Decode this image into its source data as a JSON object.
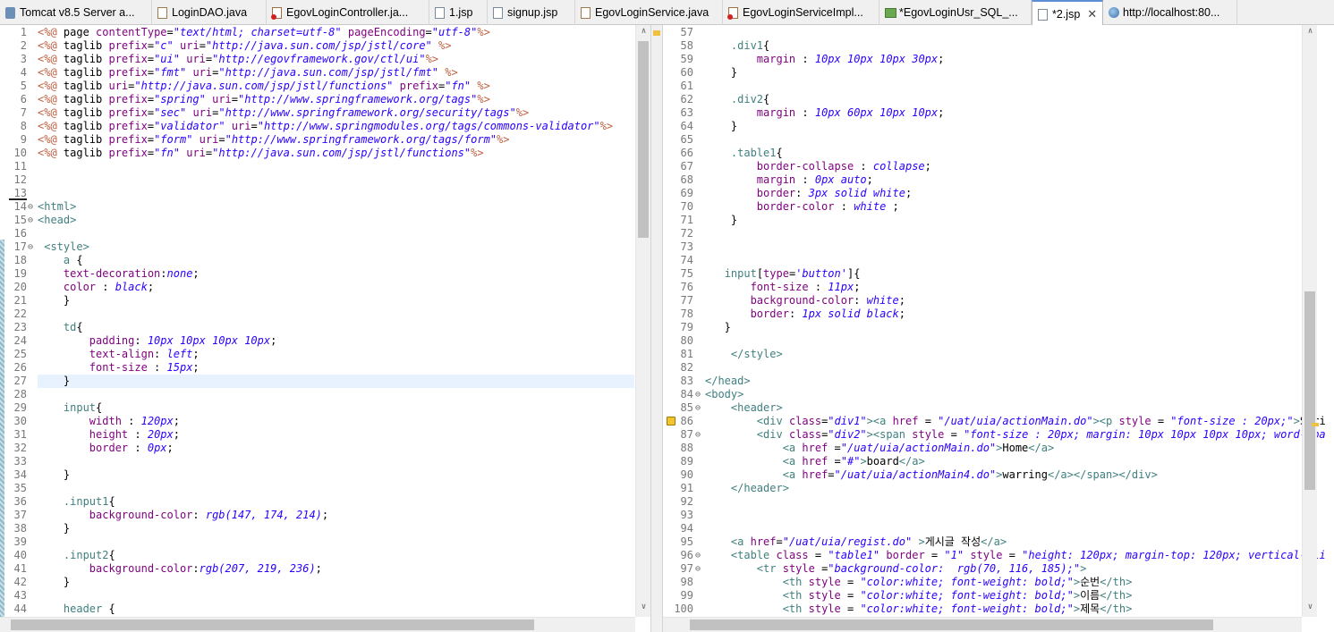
{
  "tabs": [
    {
      "label": "Tomcat v8.5 Server a...",
      "icon": "server-icon",
      "type": "srv",
      "width": 170
    },
    {
      "label": "LoginDAO.java",
      "icon": "java-file-icon",
      "type": "java",
      "width": 128
    },
    {
      "label": "EgovLoginController.ja...",
      "icon": "java-error-icon",
      "type": "err",
      "width": 182
    },
    {
      "label": "1.jsp",
      "icon": "jsp-file-icon",
      "type": "jsp",
      "width": 65
    },
    {
      "label": "signup.jsp",
      "icon": "jsp-file-icon",
      "type": "jsp",
      "width": 98
    },
    {
      "label": "EgovLoginService.java",
      "icon": "java-file-icon",
      "type": "java",
      "width": 165
    },
    {
      "label": "EgovLoginServiceImpl...",
      "icon": "java-error-icon",
      "type": "err",
      "width": 175
    },
    {
      "label": "*EgovLoginUsr_SQL_...",
      "icon": "sql-file-icon",
      "type": "sql",
      "width": 170
    },
    {
      "label": "*2.jsp",
      "icon": "jsp-file-icon",
      "type": "jsp",
      "width": 80,
      "active": true,
      "close": "✕"
    },
    {
      "label": "http://localhost:80...",
      "icon": "globe-icon",
      "type": "globe",
      "width": 150
    }
  ],
  "left_lines": [
    {
      "n": "1",
      "h": "<span class='jd'>&lt;%@</span> page <span class='p'>contentType</span>=<span class='v'>\"text/html; charset=utf-8\"</span> <span class='p'>pageEncoding</span>=<span class='v'>\"utf-8\"</span><span class='jd'>%&gt;</span>"
    },
    {
      "n": "2",
      "h": "<span class='jd'>&lt;%@</span> taglib <span class='p'>prefix</span>=<span class='v'>\"c\"</span> <span class='p'>uri</span>=<span class='v'>\"http://java.sun.com/jsp/jstl/core\"</span> <span class='jd'>%&gt;</span>"
    },
    {
      "n": "3",
      "h": "<span class='jd'>&lt;%@</span> taglib <span class='p'>prefix</span>=<span class='v'>\"ui\"</span> <span class='p'>uri</span>=<span class='v'>\"http://egovframework.gov/ctl/ui\"</span><span class='jd'>%&gt;</span>"
    },
    {
      "n": "4",
      "h": "<span class='jd'>&lt;%@</span> taglib <span class='p'>prefix</span>=<span class='v'>\"fmt\"</span> <span class='p'>uri</span>=<span class='v'>\"http://java.sun.com/jsp/jstl/fmt\"</span> <span class='jd'>%&gt;</span>"
    },
    {
      "n": "5",
      "h": "<span class='jd'>&lt;%@</span> taglib <span class='p'>uri</span>=<span class='v'>\"http://java.sun.com/jsp/jstl/functions\"</span> <span class='p'>prefix</span>=<span class='v'>\"fn\"</span> <span class='jd'>%&gt;</span>"
    },
    {
      "n": "6",
      "h": "<span class='jd'>&lt;%@</span> taglib <span class='p'>prefix</span>=<span class='v'>\"spring\"</span> <span class='p'>uri</span>=<span class='v'>\"http://www.springframework.org/tags\"</span><span class='jd'>%&gt;</span>"
    },
    {
      "n": "7",
      "h": "<span class='jd'>&lt;%@</span> taglib <span class='p'>prefix</span>=<span class='v'>\"sec\"</span> <span class='p'>uri</span>=<span class='v'>\"http://www.springframework.org/security/tags\"</span><span class='jd'>%&gt;</span>"
    },
    {
      "n": "8",
      "h": "<span class='jd'>&lt;%@</span> taglib <span class='p'>prefix</span>=<span class='v'>\"validator\"</span> <span class='p'>uri</span>=<span class='v'>\"http://www.springmodules.org/tags/commons-validator\"</span><span class='jd'>%&gt;</span>"
    },
    {
      "n": "9",
      "h": "<span class='jd'>&lt;%@</span> taglib <span class='p'>prefix</span>=<span class='v'>\"form\"</span> <span class='p'>uri</span>=<span class='v'>\"http://www.springframework.org/tags/form\"</span><span class='jd'>%&gt;</span>"
    },
    {
      "n": "10",
      "h": "<span class='jd'>&lt;%@</span> taglib <span class='p'>prefix</span>=<span class='v'>\"fn\"</span> <span class='p'>uri</span>=<span class='v'>\"http://java.sun.com/jsp/jstl/functions\"</span><span class='jd'>%&gt;</span>"
    },
    {
      "n": "11",
      "h": ""
    },
    {
      "n": "12",
      "h": ""
    },
    {
      "n": "13",
      "h": ""
    },
    {
      "n": "14",
      "h": "<span class='tag'>&lt;html&gt;</span>",
      "fold": "⊖"
    },
    {
      "n": "15",
      "h": "<span class='tag'>&lt;head&gt;</span>",
      "fold": "⊖"
    },
    {
      "n": "16",
      "h": ""
    },
    {
      "n": "17",
      "h": " <span class='tag'>&lt;style&gt;</span>",
      "fold": "⊖"
    },
    {
      "n": "18",
      "h": "    <span class='sel'>a</span> {"
    },
    {
      "n": "19",
      "h": "    <span class='p'>text-decoration</span>:<span class='v'>none</span>;"
    },
    {
      "n": "20",
      "h": "    <span class='p'>color</span> : <span class='v'>black</span>;"
    },
    {
      "n": "21",
      "h": "    }"
    },
    {
      "n": "22",
      "h": ""
    },
    {
      "n": "23",
      "h": "    <span class='sel'>td</span>{"
    },
    {
      "n": "24",
      "h": "        <span class='p'>padding</span>: <span class='v'>10px 10px 10px 10px</span>;"
    },
    {
      "n": "25",
      "h": "        <span class='p'>text-align</span>: <span class='v'>left</span>;"
    },
    {
      "n": "26",
      "h": "        <span class='p'>font-size</span> : <span class='v'>15px</span>;"
    },
    {
      "n": "27",
      "h": "    }",
      "cur": true
    },
    {
      "n": "28",
      "h": ""
    },
    {
      "n": "29",
      "h": "    <span class='sel'>input</span>{"
    },
    {
      "n": "30",
      "h": "        <span class='p'>width</span> : <span class='v'>120px</span>;"
    },
    {
      "n": "31",
      "h": "        <span class='p'>height</span> : <span class='v'>20px</span>;"
    },
    {
      "n": "32",
      "h": "        <span class='p'>border</span> : <span class='v'>0px</span>;"
    },
    {
      "n": "33",
      "h": ""
    },
    {
      "n": "34",
      "h": "    }"
    },
    {
      "n": "35",
      "h": ""
    },
    {
      "n": "36",
      "h": "    <span class='sel'>.input1</span>{"
    },
    {
      "n": "37",
      "h": "        <span class='p'>background-color</span>: <span class='v'>rgb(147, 174, 214)</span>;"
    },
    {
      "n": "38",
      "h": "    }"
    },
    {
      "n": "39",
      "h": ""
    },
    {
      "n": "40",
      "h": "    <span class='sel'>.input2</span>{"
    },
    {
      "n": "41",
      "h": "        <span class='p'>background-color</span>:<span class='v'>rgb(207, 219, 236)</span>;"
    },
    {
      "n": "42",
      "h": "    }"
    },
    {
      "n": "43",
      "h": ""
    },
    {
      "n": "44",
      "h": "    <span class='sel'>header</span> {"
    }
  ],
  "right_lines": [
    {
      "n": "57",
      "h": ""
    },
    {
      "n": "58",
      "h": "    <span class='sel'>.div1</span>{"
    },
    {
      "n": "59",
      "h": "        <span class='p'>margin</span> : <span class='v'>10px 10px 10px 30px</span>;"
    },
    {
      "n": "60",
      "h": "    }"
    },
    {
      "n": "61",
      "h": ""
    },
    {
      "n": "62",
      "h": "    <span class='sel'>.div2</span>{"
    },
    {
      "n": "63",
      "h": "        <span class='p'>margin</span> : <span class='v'>10px 60px 10px 10px</span>;"
    },
    {
      "n": "64",
      "h": "    }"
    },
    {
      "n": "65",
      "h": ""
    },
    {
      "n": "66",
      "h": "    <span class='sel'>.table1</span>{"
    },
    {
      "n": "67",
      "h": "        <span class='p'>border-collapse</span> : <span class='v'>collapse</span>;"
    },
    {
      "n": "68",
      "h": "        <span class='p'>margin</span> : <span class='v'>0px auto</span>;"
    },
    {
      "n": "69",
      "h": "        <span class='p'>border</span>: <span class='v'>3px solid white</span>;"
    },
    {
      "n": "70",
      "h": "        <span class='p'>border-color</span> : <span class='v'>white</span> ;"
    },
    {
      "n": "71",
      "h": "    }"
    },
    {
      "n": "72",
      "h": ""
    },
    {
      "n": "73",
      "h": ""
    },
    {
      "n": "74",
      "h": ""
    },
    {
      "n": "75",
      "h": "   <span class='sel'>input</span>[<span class='p'>type</span>=<span class='v'>'button'</span>]{"
    },
    {
      "n": "76",
      "h": "       <span class='p'>font-size</span> : <span class='v'>11px</span>;"
    },
    {
      "n": "77",
      "h": "       <span class='p'>background-color</span>: <span class='v'>white</span>;"
    },
    {
      "n": "78",
      "h": "       <span class='p'>border</span>: <span class='v'>1px solid black</span>;"
    },
    {
      "n": "79",
      "h": "   }"
    },
    {
      "n": "80",
      "h": ""
    },
    {
      "n": "81",
      "h": "    <span class='tag'>&lt;/style&gt;</span>"
    },
    {
      "n": "82",
      "h": ""
    },
    {
      "n": "83",
      "h": "<span class='tag'>&lt;/head&gt;</span>"
    },
    {
      "n": "84",
      "h": "<span class='tag'>&lt;body&gt;</span>",
      "fold": "⊖"
    },
    {
      "n": "85",
      "h": "    <span class='tag'>&lt;header&gt;</span>",
      "fold": "⊖"
    },
    {
      "n": "86",
      "h": "        <span class='tag'>&lt;div</span> <span class='p'>class</span>=<span class='v'>\"div1\"</span><span class='tag'>&gt;&lt;a</span> <span class='p'>href</span> = <span class='v'>\"/uat/uia/actionMain.do\"</span><span class='tag'>&gt;&lt;p</span> <span class='p'>style</span> = <span class='v'>\"font-size : 20px;\"</span><span class='tag'>&gt;</span>Spri",
      "warn": true
    },
    {
      "n": "87",
      "h": "        <span class='tag'>&lt;div</span> <span class='p'>class</span>=<span class='v'>\"div2\"</span><span class='tag'>&gt;&lt;span</span> <span class='p'>style</span> = <span class='v'>\"font-size : 20px; margin: 10px 10px 10px 10px; word-spa</span>",
      "fold": "⊖"
    },
    {
      "n": "88",
      "h": "            <span class='tag'>&lt;a</span> <span class='p'>href</span> =<span class='v'>\"/uat/uia/actionMain.do\"</span><span class='tag'>&gt;</span>Home<span class='tag'>&lt;/a&gt;</span>"
    },
    {
      "n": "89",
      "h": "            <span class='tag'>&lt;a</span> <span class='p'>href</span> =<span class='v'>\"#\"</span><span class='tag'>&gt;</span>board<span class='tag'>&lt;/a&gt;</span>"
    },
    {
      "n": "90",
      "h": "            <span class='tag'>&lt;a</span> <span class='p'>href</span>=<span class='v'>\"/uat/uia/actionMain4.do\"</span><span class='tag'>&gt;</span>warring<span class='tag'>&lt;/a&gt;&lt;/span&gt;&lt;/div&gt;</span>"
    },
    {
      "n": "91",
      "h": "    <span class='tag'>&lt;/header&gt;</span>"
    },
    {
      "n": "92",
      "h": ""
    },
    {
      "n": "93",
      "h": ""
    },
    {
      "n": "94",
      "h": ""
    },
    {
      "n": "95",
      "h": "    <span class='tag'>&lt;a</span> <span class='p'>href</span>=<span class='v'>\"/uat/uia/regist.do\"</span> <span class='tag'>&gt;</span>게시글 작성<span class='tag'>&lt;/a&gt;</span>"
    },
    {
      "n": "96",
      "h": "    <span class='tag'>&lt;table</span> <span class='p'>class</span> = <span class='v'>\"table1\"</span> <span class='p'>border</span> = <span class='v'>\"1\"</span> <span class='p'>style</span> = <span class='v'>\"height: 120px; margin-top: 120px; vertical-ali</span>",
      "fold": "⊖"
    },
    {
      "n": "97",
      "h": "        <span class='tag'>&lt;tr</span> <span class='p'>style</span> =<span class='v'>\"background-color:  rgb(70, 116, 185);\"</span><span class='tag'>&gt;</span>",
      "fold": "⊖"
    },
    {
      "n": "98",
      "h": "            <span class='tag'>&lt;th</span> <span class='p'>style</span> = <span class='v'>\"color:white; font-weight: bold;\"</span><span class='tag'>&gt;</span>순번<span class='tag'>&lt;/th&gt;</span>"
    },
    {
      "n": "99",
      "h": "            <span class='tag'>&lt;th</span> <span class='p'>style</span> = <span class='v'>\"color:white; font-weight: bold;\"</span><span class='tag'>&gt;</span>이름<span class='tag'>&lt;/th&gt;</span>"
    },
    {
      "n": "100",
      "h": "            <span class='tag'>&lt;th</span> <span class='p'>style</span> = <span class='v'>\"color:white; font-weight: bold;\"</span><span class='tag'>&gt;</span>제목<span class='tag'>&lt;/th&gt;</span>"
    }
  ]
}
